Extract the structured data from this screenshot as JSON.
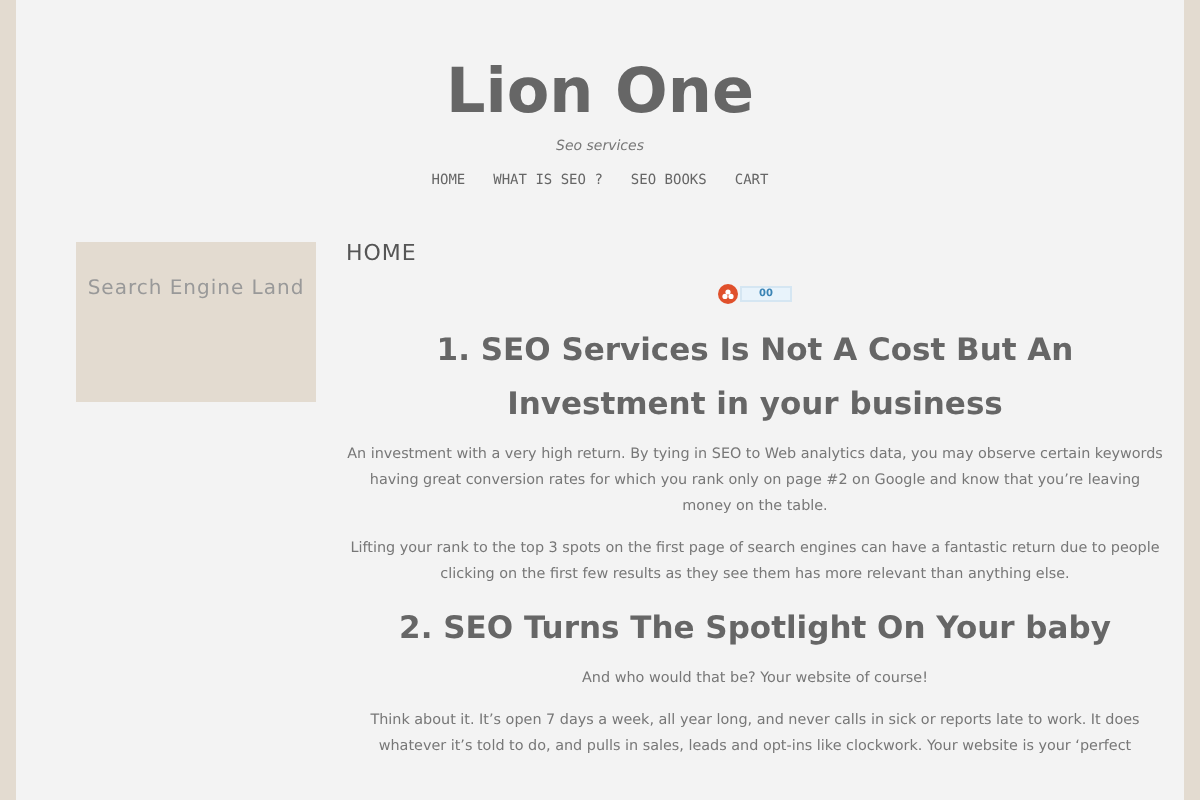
{
  "site": {
    "title": "Lion One",
    "tagline": "Seo services"
  },
  "nav": [
    {
      "label": "HOME"
    },
    {
      "label": "WHAT IS SEO ?"
    },
    {
      "label": "SEO BOOKS"
    },
    {
      "label": "CART"
    }
  ],
  "sidebar": {
    "widget_title": "Search Engine Land"
  },
  "page": {
    "title": "HOME",
    "share_count": "00",
    "sections": [
      {
        "heading": "1.  SEO Services Is Not A Cost But An Investment in your business",
        "paragraphs": [
          "An investment with a very high return. By tying in SEO to Web analytics data, you may observe certain keywords having great conversion rates for which you rank only on page #2 on Google and know that you’re leaving money on the table.",
          "Lifting your rank to the top 3 spots on the first page of search engines can have a fantastic return due to people clicking on the first few results as they see them has more relevant than anything else."
        ]
      },
      {
        "heading": "2.  SEO Turns The Spotlight On Your baby",
        "paragraphs": [
          "And who would that be? Your website of course!",
          "Think about it. It’s open 7 days a week, all year long, and never calls in sick or reports late to work. It does whatever it’s told to do, and pulls in sales, leads and opt-ins like clockwork. Your website is your ‘perfect"
        ]
      }
    ]
  }
}
